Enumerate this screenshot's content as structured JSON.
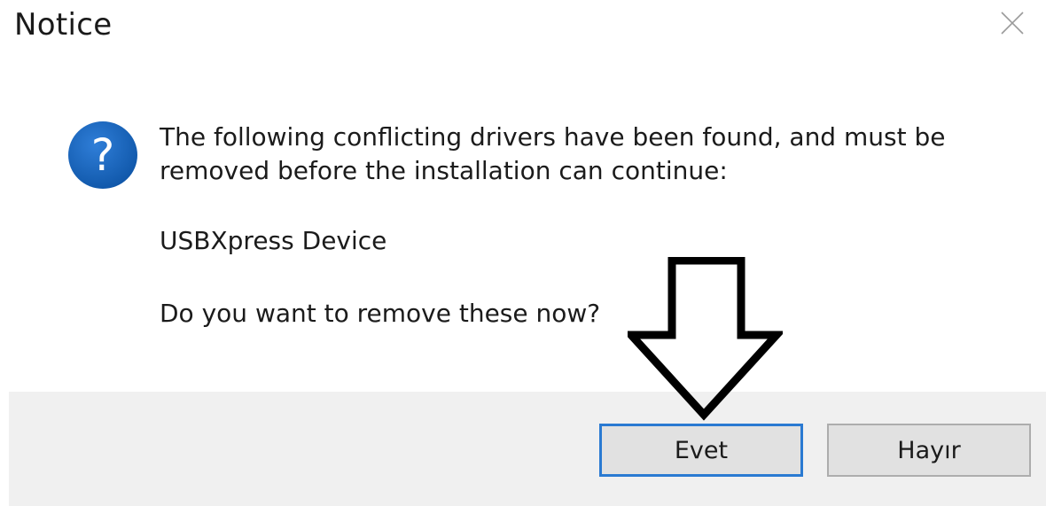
{
  "dialog": {
    "title": "Notice",
    "close_icon": "close-icon",
    "message": "The following conflicting drivers have been found, and must be removed before the installation can continue:",
    "message_line1": "The following conflicting drivers have been found, and must be",
    "message_line2": "removed before the installation can continue:",
    "device_name": "USBXpress Device",
    "question": "Do you want to remove these now?",
    "icon": "question-icon",
    "icon_color": "#1a5fb4"
  },
  "buttons": {
    "yes_label": "Evet",
    "no_label": "Hayır"
  },
  "annotation": {
    "icon": "down-arrow-icon"
  }
}
